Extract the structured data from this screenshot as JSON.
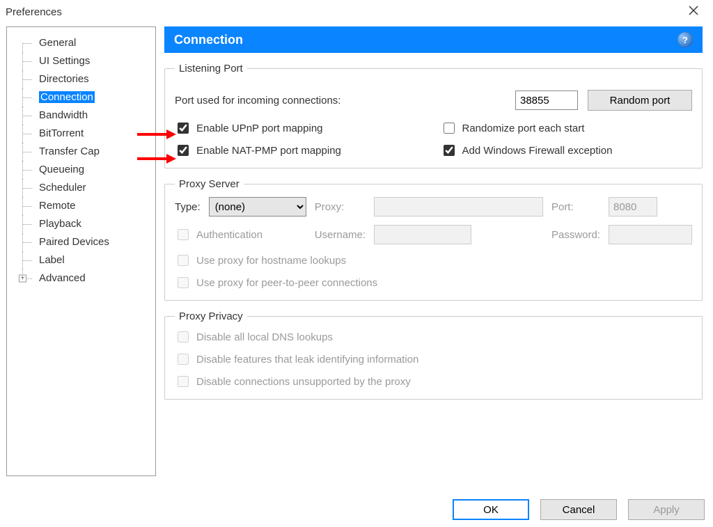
{
  "window": {
    "title": "Preferences"
  },
  "sidebar": {
    "items": [
      {
        "label": "General"
      },
      {
        "label": "UI Settings"
      },
      {
        "label": "Directories"
      },
      {
        "label": "Connection",
        "selected": true
      },
      {
        "label": "Bandwidth"
      },
      {
        "label": "BitTorrent"
      },
      {
        "label": "Transfer Cap"
      },
      {
        "label": "Queueing"
      },
      {
        "label": "Scheduler"
      },
      {
        "label": "Remote"
      },
      {
        "label": "Playback"
      },
      {
        "label": "Paired Devices"
      },
      {
        "label": "Label"
      },
      {
        "label": "Advanced",
        "expander": "+"
      }
    ]
  },
  "panel": {
    "title": "Connection",
    "help_glyph": "?"
  },
  "listening": {
    "legend": "Listening Port",
    "port_label": "Port used for incoming connections:",
    "port_value": "38855",
    "random_port_btn": "Random port",
    "upnp_label": "Enable UPnP port mapping",
    "upnp_checked": true,
    "randomize_label": "Randomize port each start",
    "randomize_checked": false,
    "natpmp_label": "Enable NAT-PMP port mapping",
    "natpmp_checked": true,
    "firewall_label": "Add Windows Firewall exception",
    "firewall_checked": true
  },
  "proxy": {
    "legend": "Proxy Server",
    "type_label": "Type:",
    "type_value": "(none)",
    "proxy_label": "Proxy:",
    "proxy_value": "",
    "port_label": "Port:",
    "port_value": "8080",
    "auth_label": "Authentication",
    "auth_checked": false,
    "username_label": "Username:",
    "username_value": "",
    "password_label": "Password:",
    "password_value": "",
    "hostname_label": "Use proxy for hostname lookups",
    "hostname_checked": false,
    "p2p_label": "Use proxy for peer-to-peer connections",
    "p2p_checked": false
  },
  "privacy": {
    "legend": "Proxy Privacy",
    "dns_label": "Disable all local DNS lookups",
    "dns_checked": false,
    "leak_label": "Disable features that leak identifying information",
    "leak_checked": false,
    "unsupported_label": "Disable connections unsupported by the proxy",
    "unsupported_checked": false
  },
  "footer": {
    "ok": "OK",
    "cancel": "Cancel",
    "apply": "Apply"
  }
}
